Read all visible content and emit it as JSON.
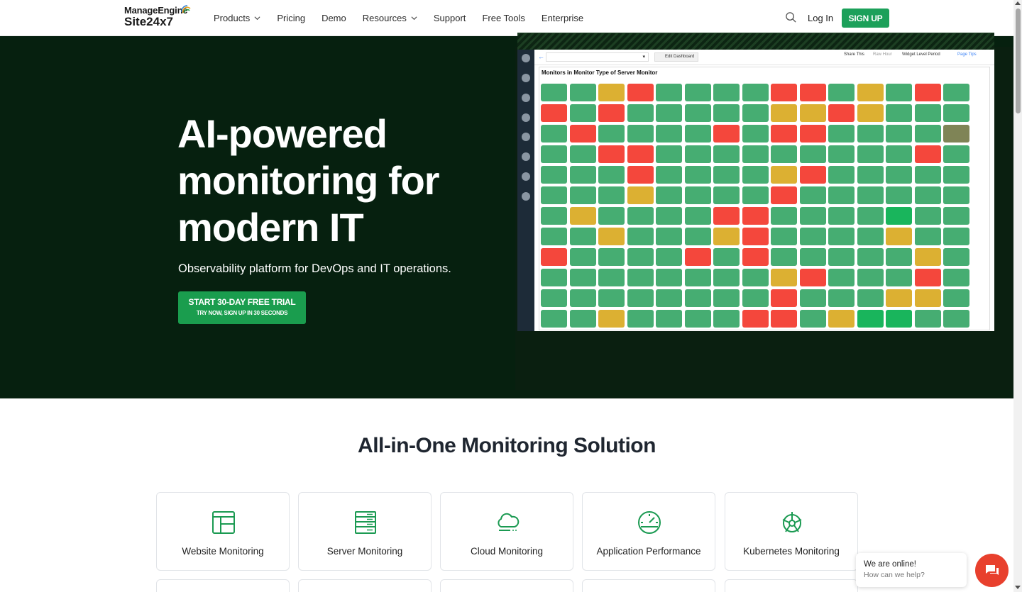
{
  "header": {
    "brand_top": "ManageEngine",
    "brand_bottom": "Site24x7",
    "nav": [
      {
        "label": "Products",
        "has_dropdown": true
      },
      {
        "label": "Pricing",
        "has_dropdown": false
      },
      {
        "label": "Demo",
        "has_dropdown": false
      },
      {
        "label": "Resources",
        "has_dropdown": true
      },
      {
        "label": "Support",
        "has_dropdown": false
      },
      {
        "label": "Free Tools",
        "has_dropdown": false
      },
      {
        "label": "Enterprise",
        "has_dropdown": false
      }
    ],
    "search_icon": "search-icon",
    "login_label": "Log In",
    "signup_label": "SIGN UP"
  },
  "hero": {
    "title": "AI-powered monitoring for modern IT",
    "subtitle": "Observability platform for DevOps and IT operations.",
    "cta_line1": "START 30-DAY FREE TRIAL",
    "cta_line2": "TRY NOW, SIGN UP IN 30 SECONDS",
    "dashboard": {
      "edit_label": "Edit Dashboard",
      "share_label": "Share This",
      "raw_label": "Raw",
      "hour_label": "Hour",
      "period_label": "Widget Level Period",
      "tips_label": "Page Tips",
      "panel_title": "Monitors in Monitor Type of Server Monitor",
      "status_colors": {
        "g": "#46ad72",
        "y": "#dcb032",
        "r": "#f4473c",
        "o": "#7f8456",
        "b": "#19b55c"
      },
      "rows": [
        "ggyrggggrrgygrg",
        "rgrgggggyyrygggg",
        "grggggrgrrggggor",
        "ggrrgggggggggrg",
        "gggrggggyrggggg",
        "gggyggggrgggggg",
        "gyggggrrggggbgg",
        "ggygggyrggggygg",
        "rggggrgrgggggyg",
        "ggggggggyrgggrg",
        "ggggggggrgggyyg",
        "ggyggggrrgybbgg"
      ]
    }
  },
  "section": {
    "title": "All-in-One Monitoring Solution",
    "cards": [
      {
        "label": "Website Monitoring",
        "icon": "website-icon"
      },
      {
        "label": "Server Monitoring",
        "icon": "server-icon"
      },
      {
        "label": "Cloud Monitoring",
        "icon": "cloud-icon"
      },
      {
        "label": "Application Performance",
        "icon": "gauge-icon"
      },
      {
        "label": "Kubernetes Monitoring",
        "icon": "kubernetes-icon"
      }
    ]
  },
  "chat": {
    "line1": "We are online!",
    "line2": "How can we help?"
  }
}
